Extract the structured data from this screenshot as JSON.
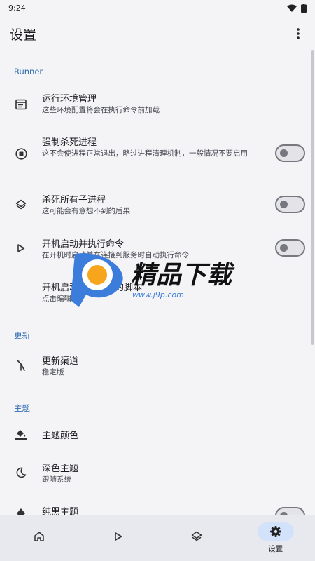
{
  "status_bar": {
    "time": "9:24"
  },
  "app_bar": {
    "title": "设置",
    "more_icon": "more-vert-icon"
  },
  "sections": {
    "runner": "Runner",
    "update": "更新",
    "theme": "主题"
  },
  "items": {
    "env": {
      "title": "运行环境管理",
      "subtitle": "这些环境配置将会在执行命令前加载",
      "icon": "environment-icon"
    },
    "force_kill": {
      "title": "强制杀死进程",
      "subtitle": "这不会使进程正常退出，略过进程清理机制，一般情况不要启用",
      "icon": "stop-circle-icon",
      "enabled": false
    },
    "kill_children": {
      "title": "杀死所有子进程",
      "subtitle": "这可能会有意想不到的后果",
      "icon": "layers-icon",
      "enabled": false
    },
    "boot_run": {
      "title": "开机启动并执行命令",
      "subtitle": "在开机时启动并在连接到服务时自动执行命令",
      "icon": "play-icon",
      "enabled": false
    },
    "boot_script": {
      "title": "开机启动时将执行的脚本",
      "subtitle": "点击编辑"
    },
    "update_channel": {
      "title": "更新渠道",
      "subtitle": "稳定版",
      "icon": "merge-icon"
    },
    "theme_color": {
      "title": "主题颜色",
      "icon": "paint-bucket-icon"
    },
    "dark_theme": {
      "title": "深色主题",
      "subtitle": "跟随系统",
      "icon": "moon-icon"
    },
    "black_theme": {
      "title": "纯黑主题",
      "icon": "contrast-icon",
      "enabled": false
    }
  },
  "watermark": {
    "brand": "精品下载",
    "url": "www.j9p.com"
  },
  "bottom_nav": {
    "items": [
      {
        "icon": "home-icon",
        "label": ""
      },
      {
        "icon": "play-icon",
        "label": ""
      },
      {
        "icon": "layers-icon",
        "label": ""
      },
      {
        "icon": "gear-icon",
        "label": "设置",
        "active": true
      }
    ]
  },
  "colors": {
    "accent": "#2f6ab1",
    "nav_active": "#d3e2fb",
    "background": "#f4f4f7"
  }
}
